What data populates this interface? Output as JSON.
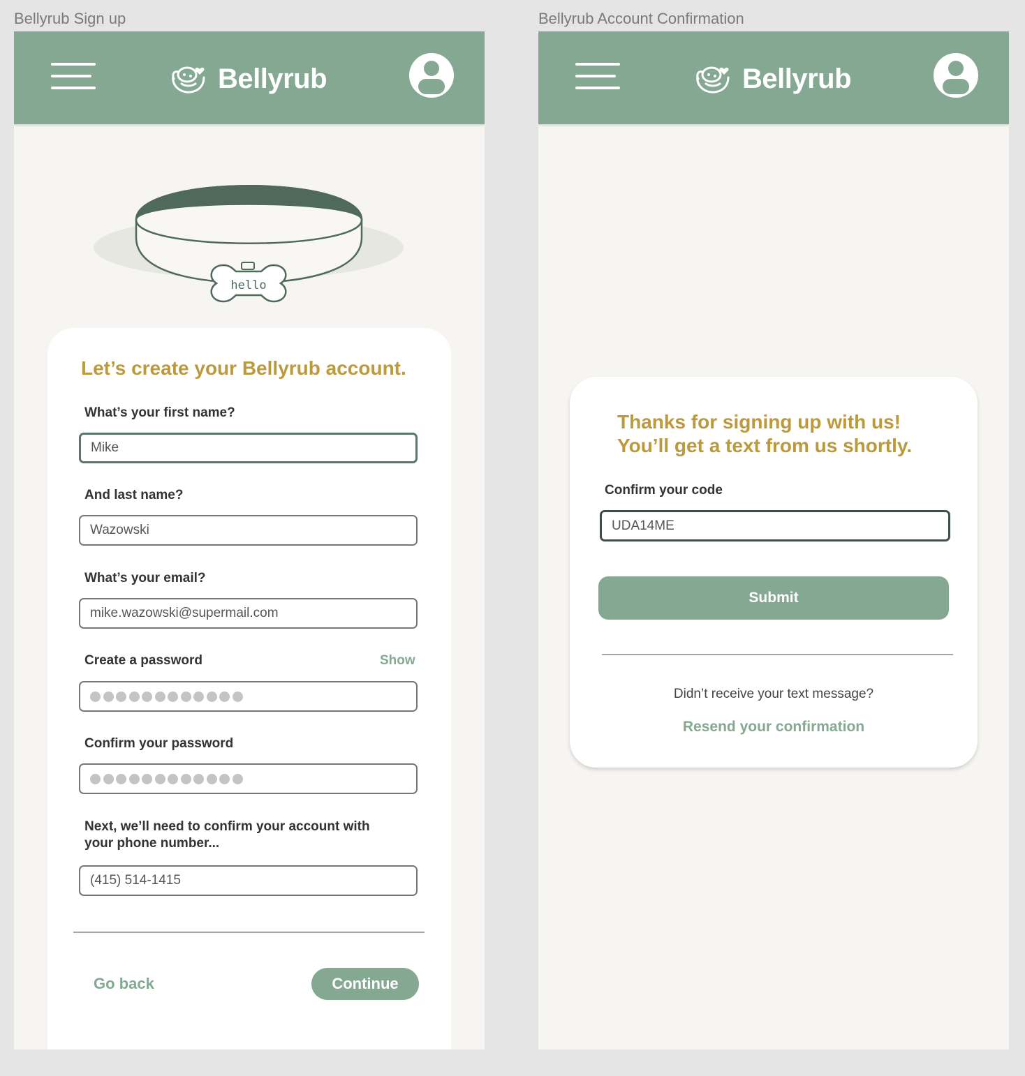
{
  "frames": {
    "signup_label": "Bellyrub Sign up",
    "confirm_label": "Bellyrub Account Confirmation"
  },
  "header": {
    "brand": "Bellyrub"
  },
  "signup": {
    "collar_tag_text": "hello",
    "title": "Let’s create your Bellyrub account.",
    "first_name_label": "What’s your first name?",
    "first_name_value": "Mike",
    "last_name_label": "And last name?",
    "last_name_value": "Wazowski",
    "email_label": "What’s your email?",
    "email_value": "mike.wazowski@supermail.com",
    "password_label": "Create a password",
    "show_label": "Show",
    "password_mask_length": 12,
    "confirm_password_label": "Confirm your password",
    "confirm_password_mask_length": 12,
    "phone_label": "Next, we’ll need to confirm your account with your phone number...",
    "phone_value": "(415) 514-1415",
    "go_back": "Go back",
    "continue": "Continue"
  },
  "confirm": {
    "title_line1": "Thanks for signing up with us!",
    "title_line2": "You’ll get a text from us shortly.",
    "code_label": "Confirm your code",
    "code_value": "UDA14ME",
    "submit": "Submit",
    "no_text_message": "Didn’t receive your text message?",
    "resend": "Resend your confirmation"
  },
  "colors": {
    "header_green": "#85a893",
    "title_gold": "#bb9a3e",
    "collar_dark_green": "#4f6a5a"
  }
}
